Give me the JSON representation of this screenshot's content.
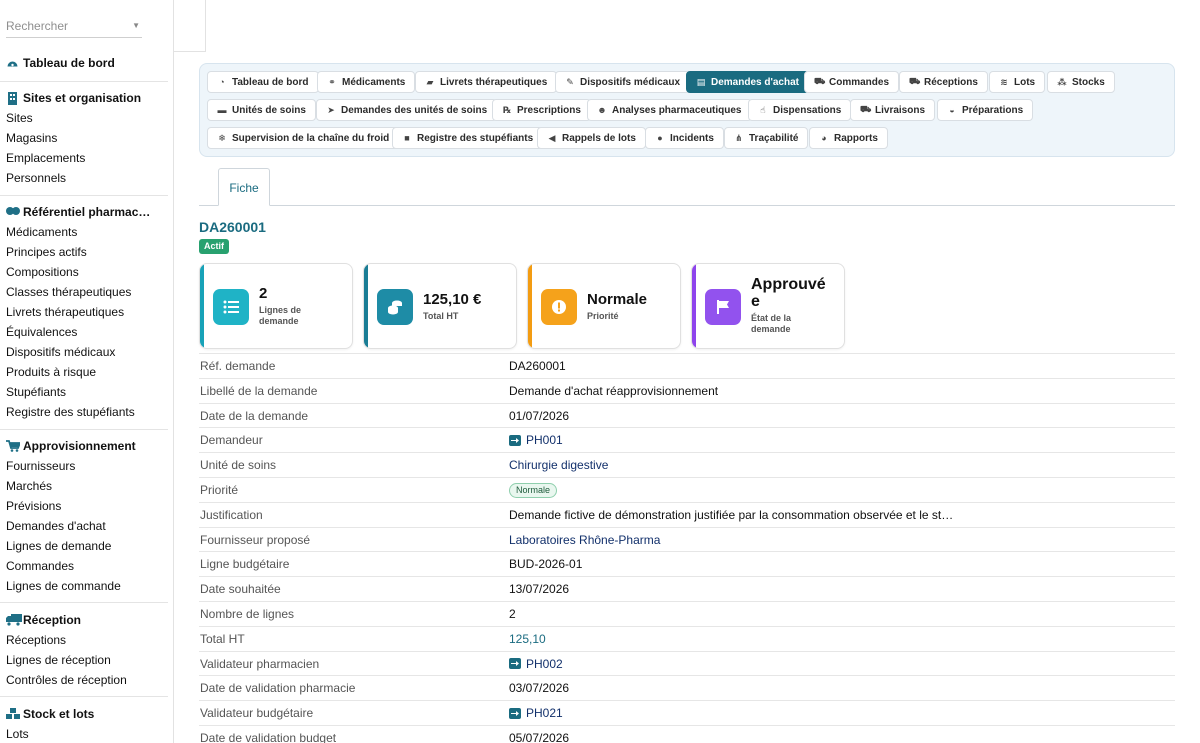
{
  "sidebar": {
    "search_placeholder": "Rechercher",
    "dashboard": "Tableau de bord",
    "sections": [
      {
        "title": "Sites et organisation",
        "icon": "building-icon",
        "items": [
          "Sites",
          "Magasins",
          "Emplacements",
          "Personnels"
        ]
      },
      {
        "title": "Référentiel pharmac…",
        "icon": "pills-icon",
        "items": [
          "Médicaments",
          "Principes actifs",
          "Compositions",
          "Classes thérapeutiques",
          "Livrets thérapeutiques",
          "Équivalences",
          "Dispositifs médicaux",
          "Produits à risque",
          "Stupéfiants",
          "Registre des stupéfiants"
        ]
      },
      {
        "title": "Approvisionnement",
        "icon": "cart-icon",
        "items": [
          "Fournisseurs",
          "Marchés",
          "Prévisions",
          "Demandes d'achat",
          "Lignes de demande",
          "Commandes",
          "Lignes de commande"
        ]
      },
      {
        "title": "Réception",
        "icon": "truck-icon",
        "items": [
          "Réceptions",
          "Lignes de réception",
          "Contrôles de réception"
        ]
      },
      {
        "title": "Stock et lots",
        "icon": "cubes-icon",
        "items": [
          "Lots"
        ]
      }
    ]
  },
  "nav": [
    [
      "Tableau de bord",
      "Médicaments",
      "Livrets thérapeutiques",
      "Dispositifs médicaux",
      "Demandes d'achat",
      "Commandes",
      "Réceptions",
      "Lots",
      "Stocks"
    ],
    [
      "Unités de soins",
      "Demandes des unités de soins",
      "Prescriptions",
      "Analyses pharmaceutiques",
      "Dispensations",
      "Livraisons",
      "Préparations"
    ],
    [
      "Supervision de la chaîne du froid",
      "Registre des stupéfiants",
      "Rappels de lots",
      "Incidents",
      "Traçabilité",
      "Rapports"
    ]
  ],
  "nav_active": "Demandes d'achat",
  "tabs": {
    "fiche": "Fiche"
  },
  "record": {
    "id": "DA260001",
    "status": "Actif"
  },
  "cards": [
    {
      "value": "2",
      "label": "Lignes de demande",
      "color": "#17a2b8"
    },
    {
      "value": "125,10 €",
      "label": "Total HT",
      "color": "#1a7d95"
    },
    {
      "value": "Normale",
      "label": "Priorité",
      "color": "#f39c12"
    },
    {
      "value": "Approuvée",
      "label": "État de la demande",
      "color": "#8e44ec"
    }
  ],
  "details": {
    "ref_label": "Réf. demande",
    "ref_value": "DA260001",
    "libelle_label": "Libellé de la demande",
    "libelle_value": "Demande d'achat réapprovisionnement",
    "date_label": "Date de la demande",
    "date_value": "01/07/2026",
    "demandeur_label": "Demandeur",
    "demandeur_value": "PH001",
    "unite_label": "Unité de soins",
    "unite_value": "Chirurgie digestive",
    "priorite_label": "Priorité",
    "priorite_value": "Normale",
    "justif_label": "Justification",
    "justif_value": "Demande fictive de démonstration justifiée par la consommation observée et le st…",
    "fourn_label": "Fournisseur proposé",
    "fourn_value": "Laboratoires Rhône-Pharma",
    "budget_label": "Ligne budgétaire",
    "budget_value": "BUD-2026-01",
    "souhait_label": "Date souhaitée",
    "souhait_value": "13/07/2026",
    "nb_label": "Nombre de lignes",
    "nb_value": "2",
    "total_label": "Total HT",
    "total_value": "125,10",
    "valpharm_label": "Validateur pharmacien",
    "valpharm_value": "PH002",
    "datepharm_label": "Date de validation pharmacie",
    "datepharm_value": "03/07/2026",
    "valbud_label": "Validateur budgétaire",
    "valbud_value": "PH021",
    "datebud_label": "Date de validation budget",
    "datebud_value": "05/07/2026"
  }
}
